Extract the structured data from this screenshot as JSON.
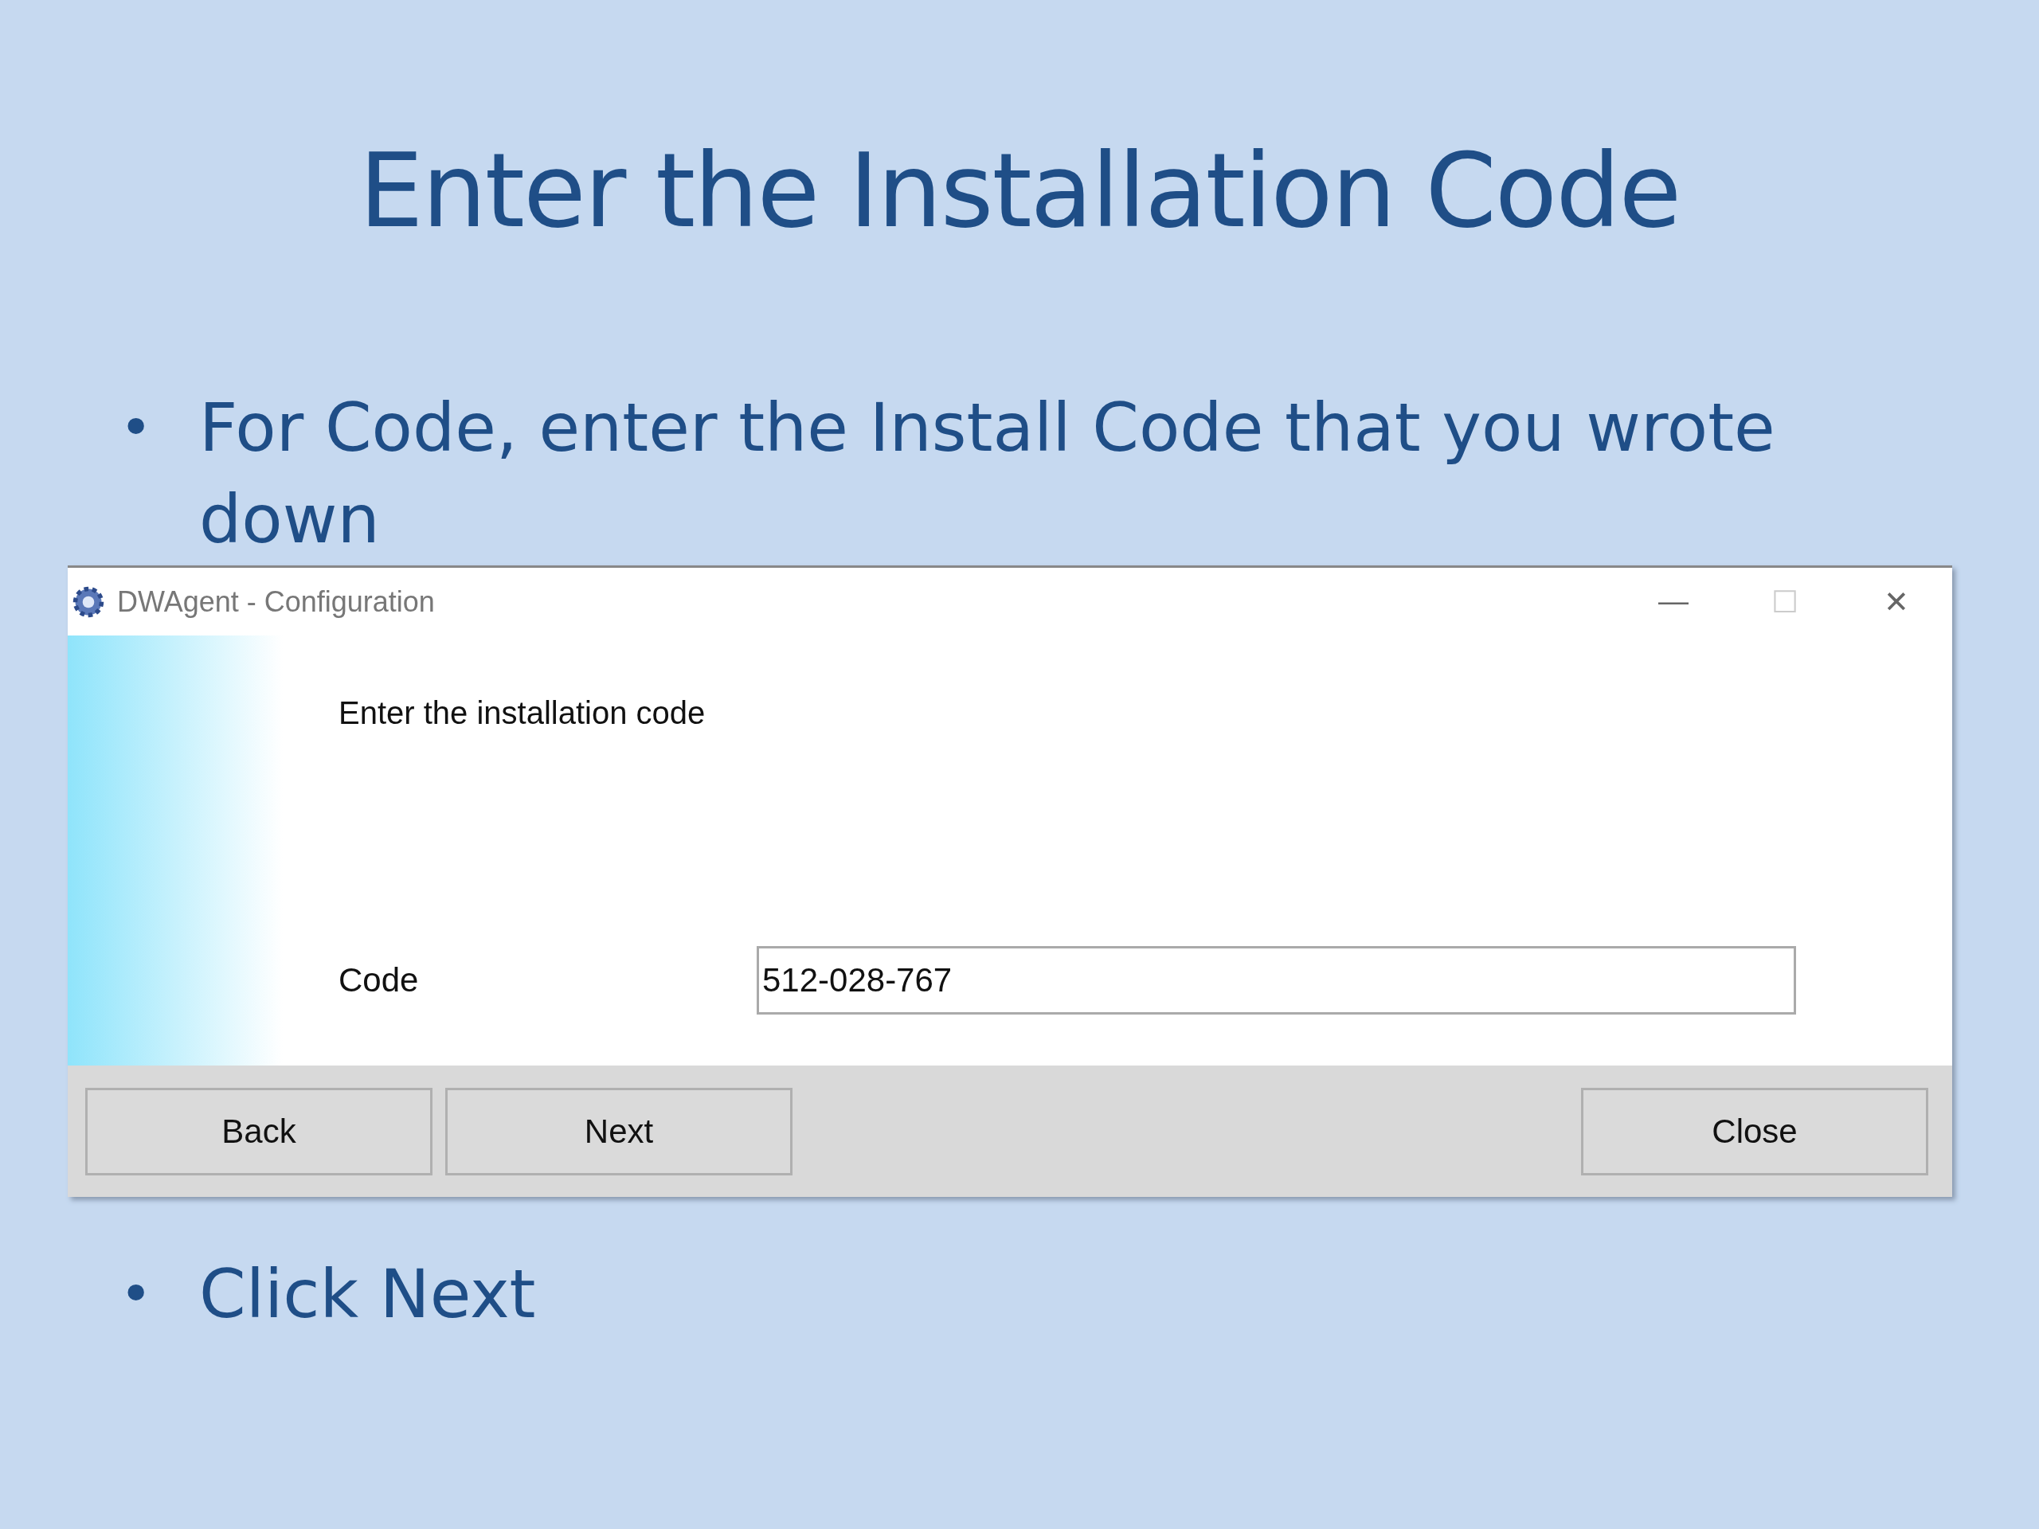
{
  "slide": {
    "title": "Enter the Installation Code",
    "bullets": [
      {
        "marker": "•",
        "text": "For Code, enter the Install Code that you wrote down"
      },
      {
        "marker": "•",
        "text": "Click Next"
      }
    ]
  },
  "window": {
    "title": "DWAgent - Configuration",
    "controls": [
      "—",
      "☐",
      "✕"
    ],
    "heading": "Enter the installation code",
    "field": {
      "label": "Code",
      "value": "512-028-767"
    },
    "buttons": [
      {
        "label": "Back",
        "kind": "left"
      },
      {
        "label": "Next",
        "kind": "left"
      },
      {
        "label": "Close",
        "kind": "right"
      }
    ]
  }
}
